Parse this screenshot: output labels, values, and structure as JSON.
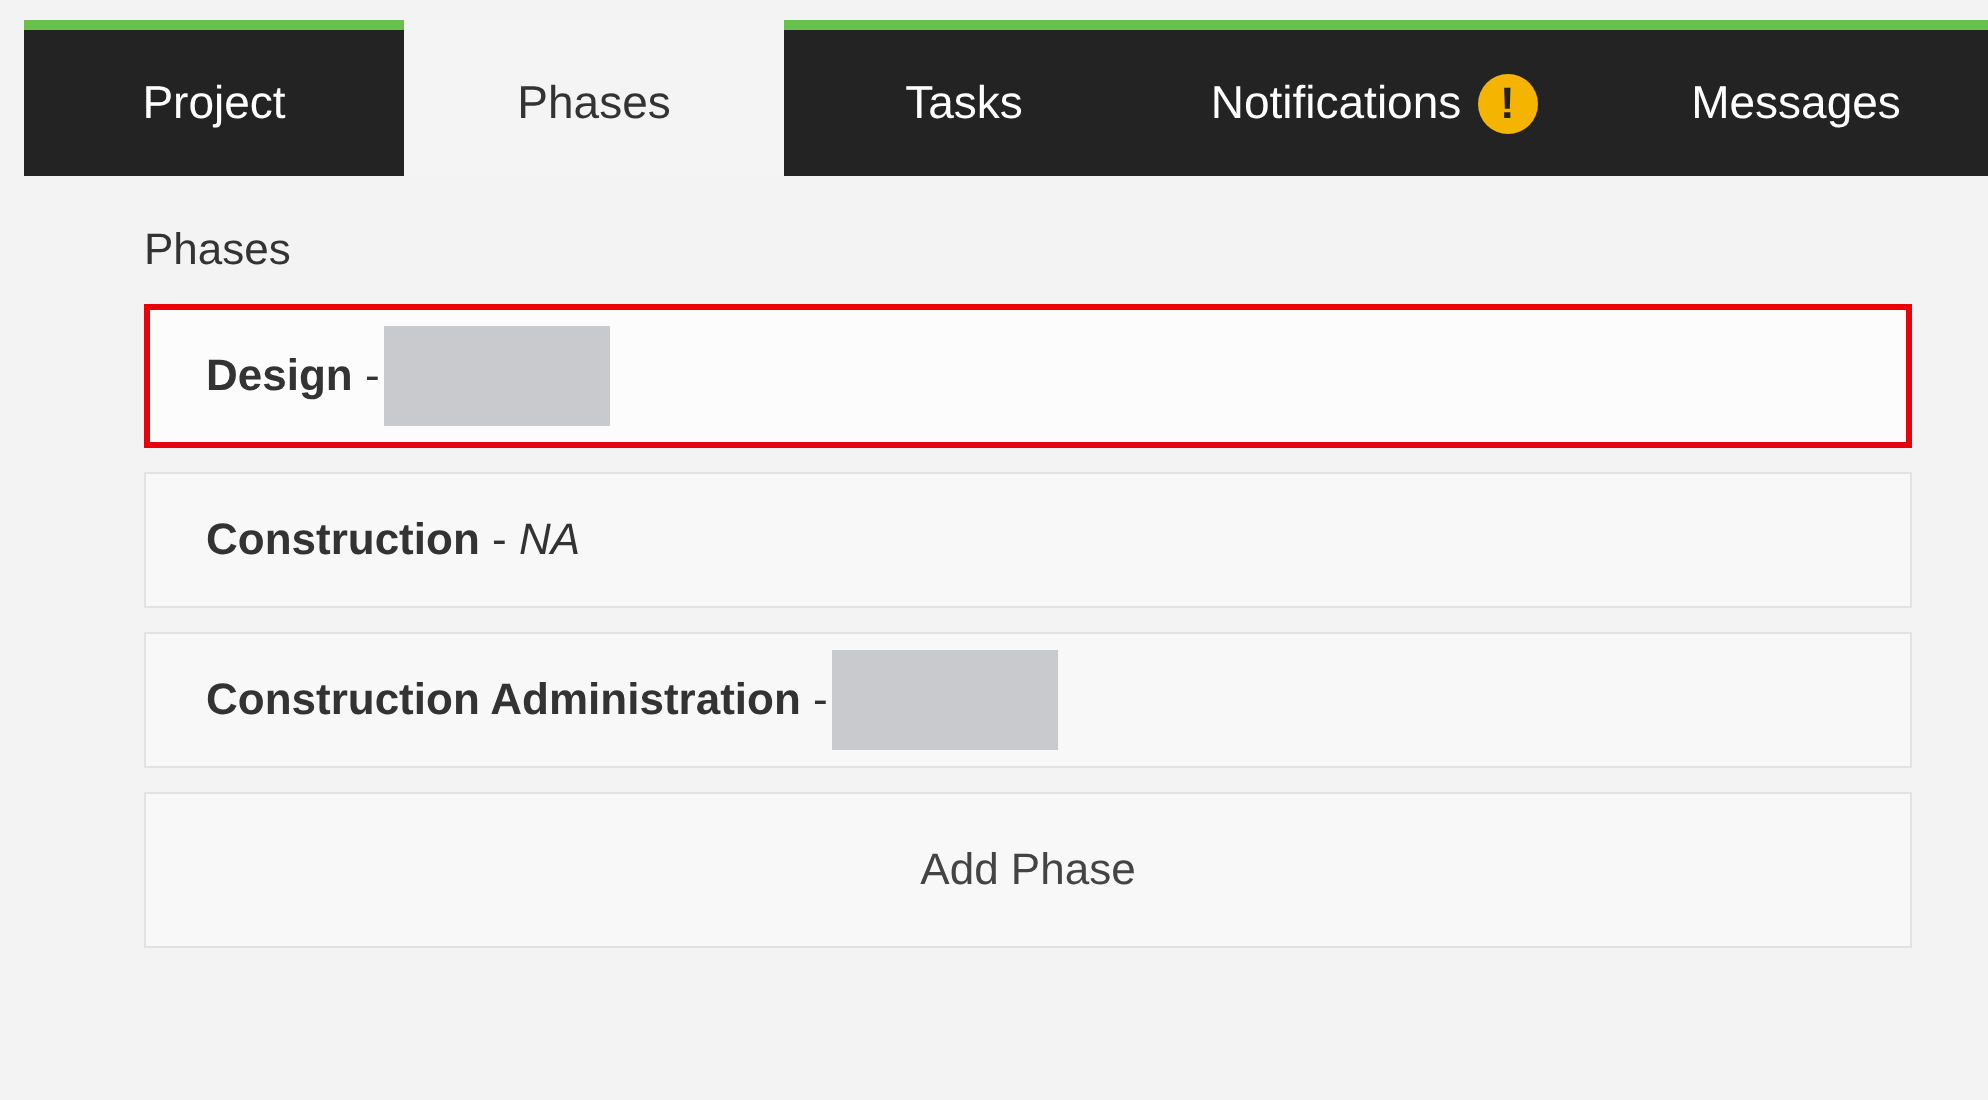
{
  "tabs": [
    {
      "label": "Project",
      "selected": false
    },
    {
      "label": "Phases",
      "selected": true
    },
    {
      "label": "Tasks",
      "selected": false
    },
    {
      "label": "Notifications",
      "selected": false,
      "badge": "!"
    },
    {
      "label": "Messages",
      "selected": false
    }
  ],
  "section_title": "Phases",
  "phases": [
    {
      "text": "**Design** -",
      "redacted": true,
      "highlighted": true
    },
    {
      "text": "**Construction** - *NA*",
      "redacted": false,
      "highlighted": false
    },
    {
      "text": "**Construction Administration** -",
      "redacted": true,
      "highlighted": false
    }
  ],
  "add_button": "Add Phase"
}
